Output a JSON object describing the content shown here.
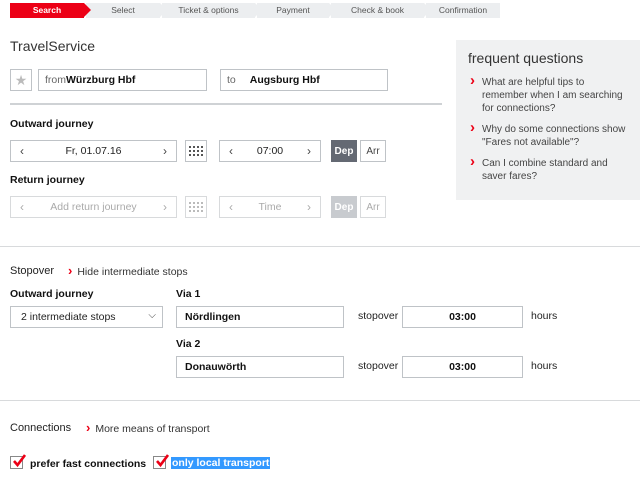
{
  "steps": [
    "Search",
    "Select",
    "Ticket & options",
    "Payment",
    "Check & book",
    "Confirmation"
  ],
  "app_title": "TravelService",
  "route": {
    "from_prefix": "from",
    "from_value": "Würzburg Hbf",
    "to_prefix": "to",
    "to_value": "Augsburg Hbf"
  },
  "outward": {
    "heading": "Outward journey",
    "date": "Fr, 01.07.16",
    "time": "07:00",
    "dep": "Dep",
    "arr": "Arr"
  },
  "return": {
    "heading": "Return journey",
    "date_placeholder": "Add return journey",
    "time_placeholder": "Time",
    "dep": "Dep",
    "arr": "Arr"
  },
  "faq": {
    "title": "frequent questions",
    "questions": [
      "What are helpful tips to remember when I am searching for connections?",
      "Why do some connections show \"Fares not available\"?",
      "Can I combine standard and saver fares?"
    ]
  },
  "stopover": {
    "label": "Stopover",
    "hide_link": "Hide intermediate stops",
    "journey_label": "Outward journey",
    "select_value": "2 intermediate stops",
    "via1_label": "Via 1",
    "via1_value": "Nördlingen",
    "via1_stopover_label": "stopover",
    "via1_time": "03:00",
    "via1_hours": "hours",
    "via2_label": "Via 2",
    "via2_value": "Donauwörth",
    "via2_stopover_label": "stopover",
    "via2_time": "03:00",
    "via2_hours": "hours"
  },
  "connections": {
    "label": "Connections",
    "more_link": "More means of transport",
    "fast_label": "prefer fast connections",
    "local_label": "only local transport"
  },
  "colors": {
    "accent": "#ec0016",
    "toggle_active": "#646973",
    "faq_bg": "#f0f1f2"
  }
}
